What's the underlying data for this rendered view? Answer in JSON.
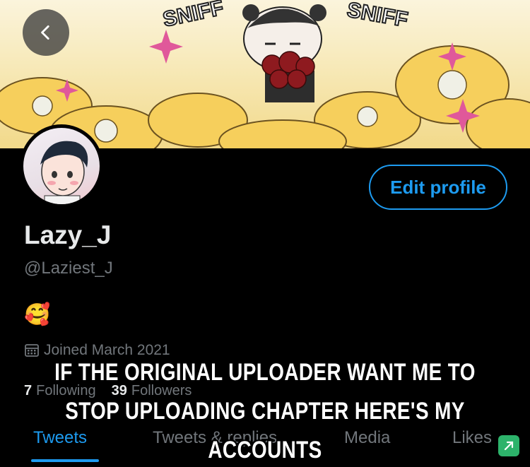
{
  "banner": {
    "sfx_left": "SNIFF",
    "sfx_right": "SNIFF"
  },
  "profile": {
    "edit_label": "Edit profile",
    "display_name": "Lazy_J",
    "handle": "@Laziest_J",
    "bio_emoji": "🥰",
    "joined": "Joined March 2021",
    "following_count": "7",
    "following_label": "Following",
    "followers_count": "39",
    "followers_label": "Followers"
  },
  "tabs": [
    {
      "label": "Tweets",
      "active": true
    },
    {
      "label": "Tweets & replies",
      "active": false
    },
    {
      "label": "Media",
      "active": false
    },
    {
      "label": "Likes",
      "active": false
    }
  ],
  "caption": {
    "line1": "IF THE ORIGINAL UPLOADER WANT ME TO",
    "line2": "STOP UPLOADING CHAPTER HERE'S MY",
    "line3": "ACCOUNTS"
  },
  "colors": {
    "accent": "#1d9bf0",
    "background": "#000000",
    "muted": "#71767b"
  }
}
